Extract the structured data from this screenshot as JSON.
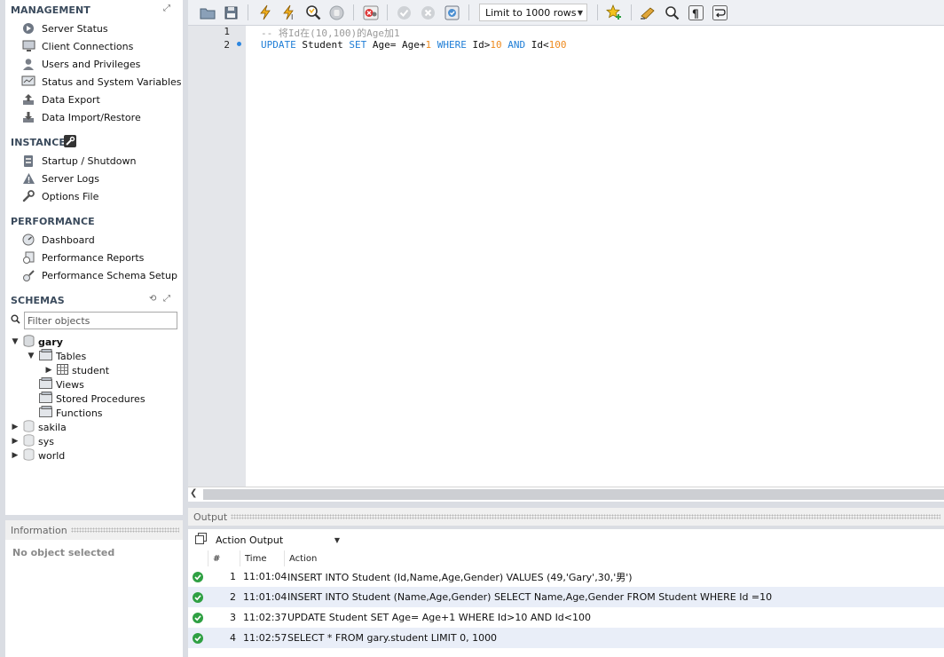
{
  "sidebar": {
    "management": {
      "title": "MANAGEMENT",
      "items": [
        "Server Status",
        "Client Connections",
        "Users and Privileges",
        "Status and System Variables",
        "Data Export",
        "Data Import/Restore"
      ]
    },
    "instance": {
      "title": "INSTANCE",
      "items": [
        "Startup / Shutdown",
        "Server Logs",
        "Options File"
      ]
    },
    "performance": {
      "title": "PERFORMANCE",
      "items": [
        "Dashboard",
        "Performance Reports",
        "Performance Schema Setup"
      ]
    },
    "schemas": {
      "title": "SCHEMAS",
      "filter_placeholder": "Filter objects",
      "tree": {
        "db": "gary",
        "tables": "Tables",
        "table1": "student",
        "views": "Views",
        "procs": "Stored Procedures",
        "funcs": "Functions",
        "others": [
          "sakila",
          "sys",
          "world"
        ]
      }
    }
  },
  "info": {
    "title": "Information",
    "body": "No object selected"
  },
  "toolbar": {
    "limit": "Limit to 1000 rows"
  },
  "editor": {
    "line_numbers": [
      "1",
      "2"
    ],
    "line1": "-- 将Id在(10,100)的Age加1",
    "line2": {
      "k_update": "UPDATE",
      "student": " Student ",
      "k_set": "SET",
      "age_eq": " Age= Age+",
      "one": "1",
      "k_where": " WHERE ",
      "id_gt": "Id>",
      "ten": "10",
      "k_and": " AND ",
      "id_lt": "Id<",
      "hundred": "100"
    }
  },
  "output": {
    "title": "Output",
    "mode": "Action Output",
    "columns": [
      "#",
      "Time",
      "Action"
    ],
    "rows": [
      {
        "n": "1",
        "time": "11:01:04",
        "action": "INSERT INTO Student (Id,Name,Age,Gender) VALUES (49,'Gary',30,'男')"
      },
      {
        "n": "2",
        "time": "11:01:04",
        "action": "INSERT INTO Student (Name,Age,Gender)   SELECT Name,Age,Gender FROM Student WHERE Id =10"
      },
      {
        "n": "3",
        "time": "11:02:37",
        "action": "UPDATE Student SET Age= Age+1 WHERE Id>10 AND Id<100"
      },
      {
        "n": "4",
        "time": "11:02:57",
        "action": "SELECT * FROM gary.student LIMIT 0, 1000"
      }
    ]
  },
  "colors": {
    "keyword": "#1f7ed6",
    "number": "#ee8a1e",
    "comment": "#9a9a9a",
    "success": "#2fa043"
  }
}
